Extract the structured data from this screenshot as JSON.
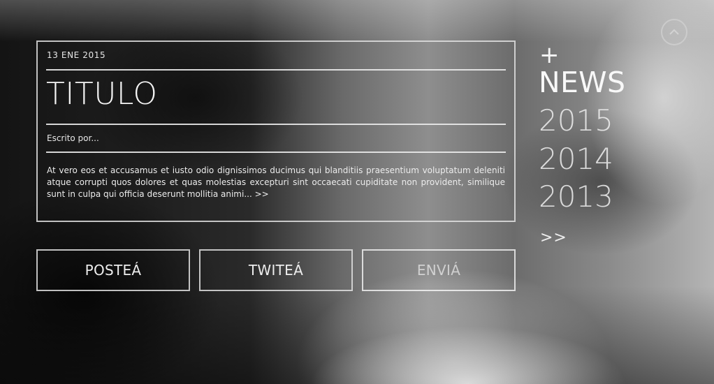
{
  "article": {
    "date": "13 ENE 2015",
    "title": "TITULO",
    "author": "Escrito por...",
    "excerpt": "At vero eos et accusamus et iusto odio dignissimos ducimus qui blanditiis praesentium voluptatum deleniti atque corrupti quos dolores et quas molestias excepturi sint occaecati cupiditate non provident, similique sunt in culpa qui officia deserunt mollitia animi...",
    "read_more": ">>"
  },
  "share_buttons": [
    {
      "label": "POSTEÁ"
    },
    {
      "label": "TWITEÁ"
    },
    {
      "label": "ENVIÁ"
    }
  ],
  "news_nav": {
    "plus": "+",
    "heading": "NEWS",
    "years": [
      "2015",
      "2014",
      "2013"
    ],
    "more": ">>"
  },
  "icons": {
    "up_button": "chevron-up-icon"
  }
}
